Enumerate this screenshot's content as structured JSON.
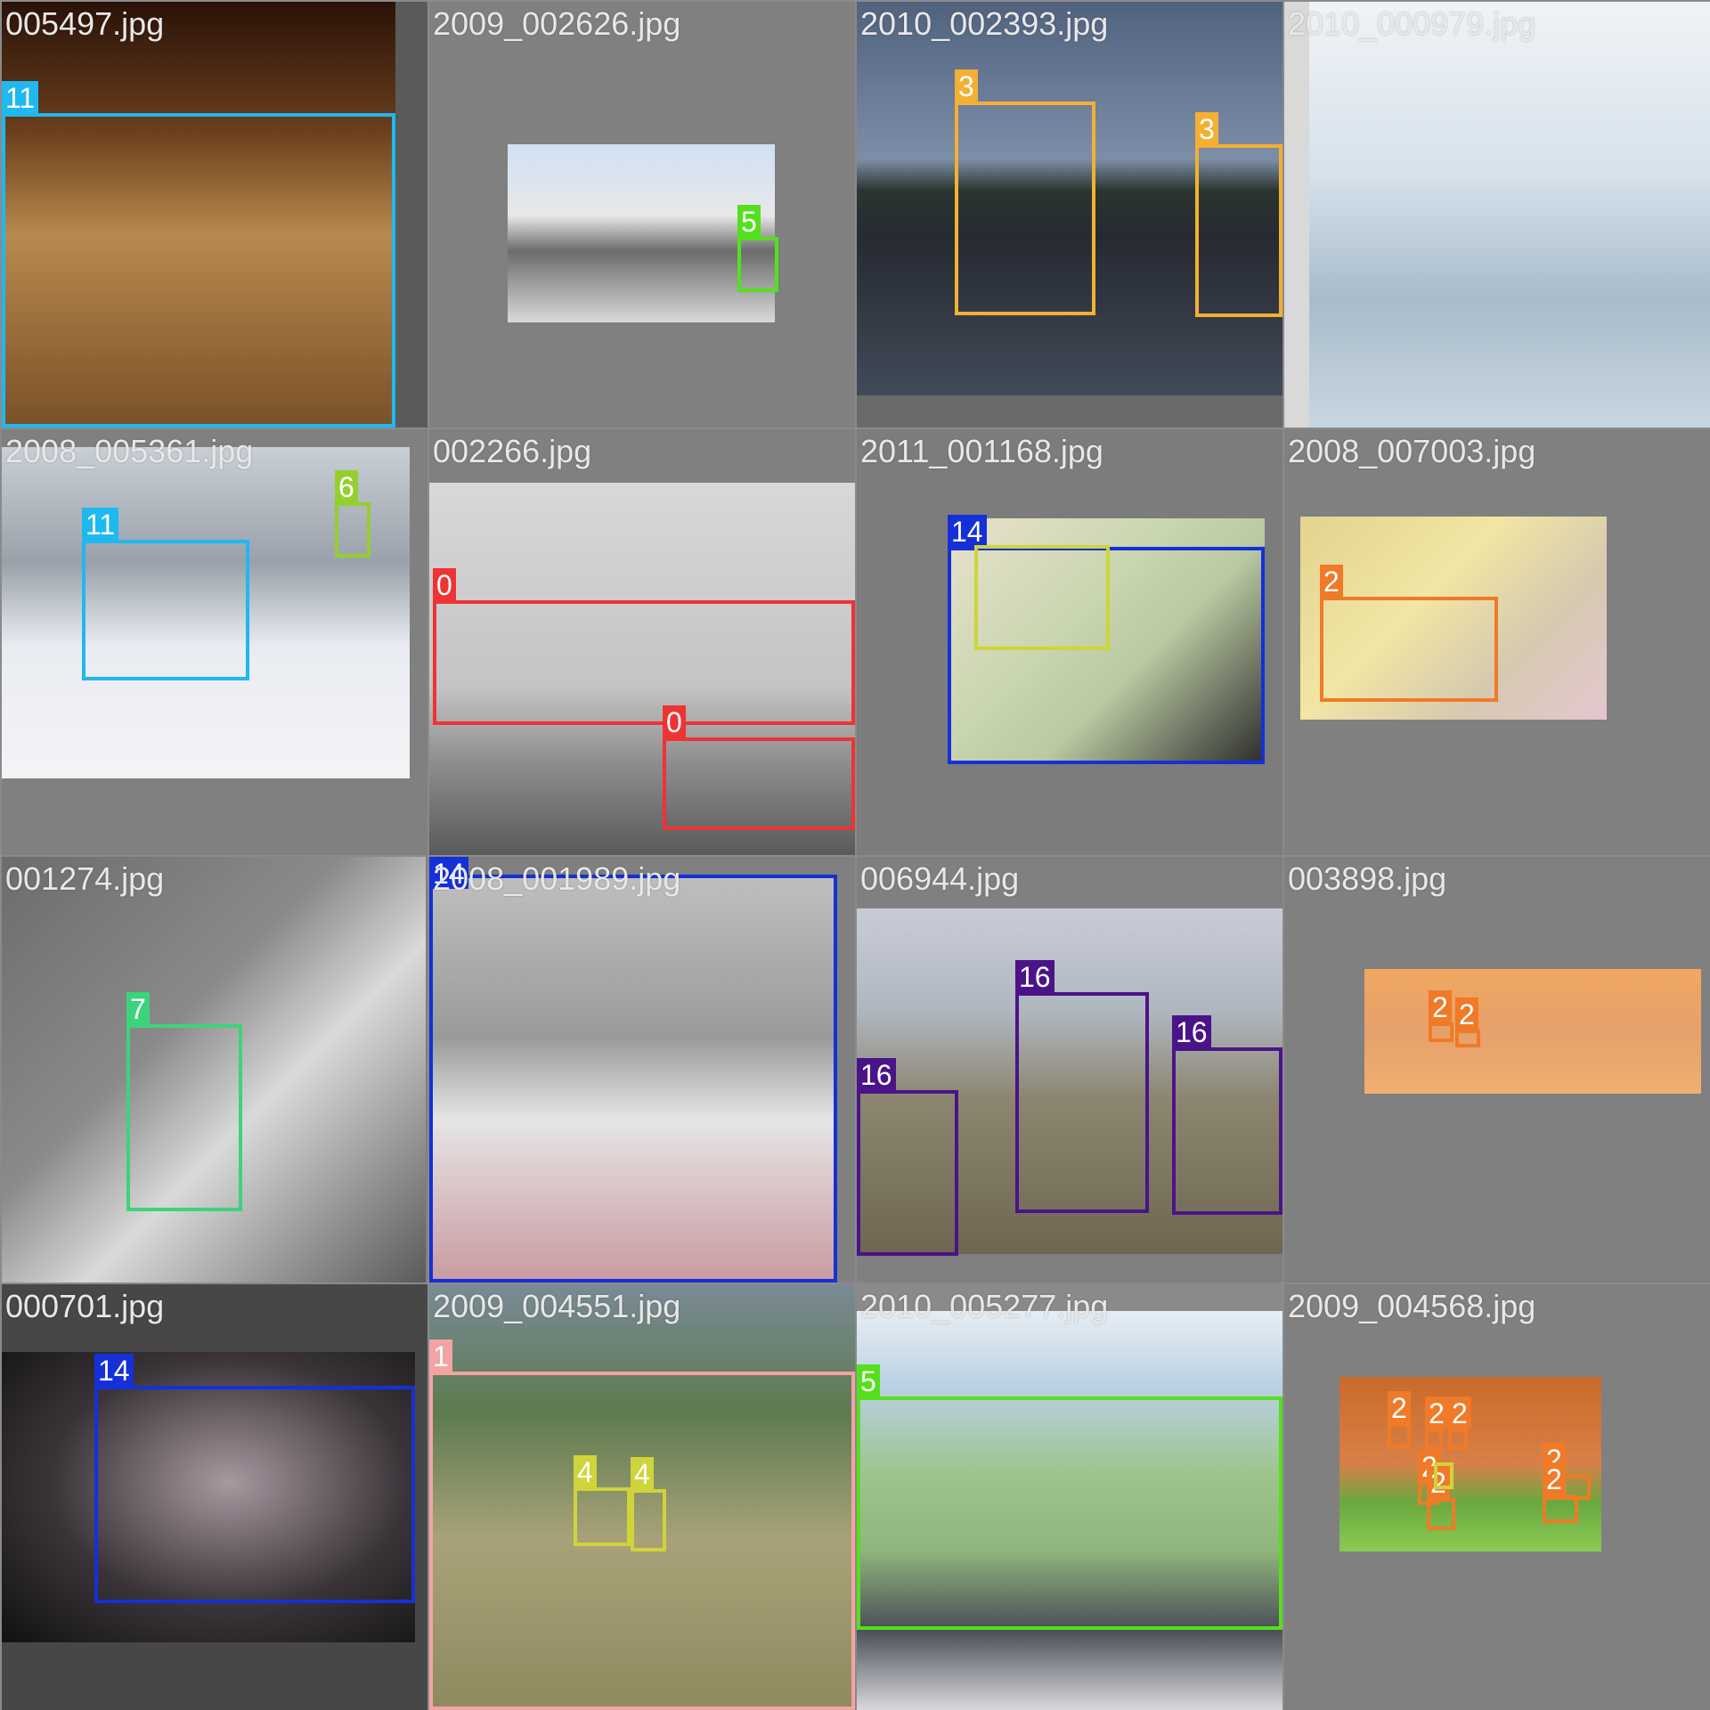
{
  "title": "",
  "class_colors": {
    "0": "#ee3333",
    "1": "#f4a3a3",
    "2": "#f07a28",
    "3": "#f3b033",
    "4": "#cfd43a",
    "5": "#55e01e",
    "6": "#95cf2e",
    "7": "#3cd47a",
    "11": "#1fb8f0",
    "14": "#1530d8",
    "16": "#4a1488"
  },
  "tiles": [
    {
      "filename": "005497.jpg",
      "scene": "dog",
      "boxes": [
        {
          "label": "11"
        }
      ]
    },
    {
      "filename": "2009_002626.jpg",
      "scene": "walkway",
      "boxes": [
        {
          "label": "5"
        }
      ]
    },
    {
      "filename": "2010_002393.jpg",
      "scene": "sailboats",
      "boxes": [
        {
          "label": "3"
        },
        {
          "label": "3"
        }
      ]
    },
    {
      "filename": "2010_000979.jpg",
      "scene": "skyline",
      "boxes": []
    },
    {
      "filename": "2008_005361.jpg",
      "scene": "snow-dog",
      "boxes": [
        {
          "label": "11"
        },
        {
          "label": "6"
        }
      ]
    },
    {
      "filename": "002266.jpg",
      "scene": "airplanes",
      "boxes": [
        {
          "label": "0"
        },
        {
          "label": "0"
        }
      ]
    },
    {
      "filename": "2011_001168.jpg",
      "scene": "baby-bottle",
      "boxes": [
        {
          "label": "14"
        },
        {
          "label": ""
        }
      ]
    },
    {
      "filename": "2008_007003.jpg",
      "scene": "hummingbird",
      "boxes": [
        {
          "label": "2"
        }
      ]
    },
    {
      "filename": "001274.jpg",
      "scene": "cat-tree",
      "boxes": [
        {
          "label": "7"
        }
      ]
    },
    {
      "filename": "2008_001989.jpg",
      "scene": "girl-mask",
      "boxes": [
        {
          "label": "14"
        }
      ]
    },
    {
      "filename": "006944.jpg",
      "scene": "sheep",
      "boxes": [
        {
          "label": "16"
        },
        {
          "label": "16"
        },
        {
          "label": "16"
        }
      ]
    },
    {
      "filename": "003898.jpg",
      "scene": "ducks",
      "boxes": [
        {
          "label": "2"
        },
        {
          "label": "2"
        }
      ]
    },
    {
      "filename": "000701.jpg",
      "scene": "eye-makeup",
      "boxes": [
        {
          "label": "14"
        }
      ]
    },
    {
      "filename": "2009_004551.jpg",
      "scene": "bicycle",
      "boxes": [
        {
          "label": "1"
        },
        {
          "label": "4"
        },
        {
          "label": "4"
        }
      ]
    },
    {
      "filename": "2010_005277.jpg",
      "scene": "bus",
      "boxes": [
        {
          "label": "5"
        }
      ]
    },
    {
      "filename": "2009_004568.jpg",
      "scene": "birds-lawn",
      "boxes": [
        {
          "label": "2"
        },
        {
          "label": "2"
        },
        {
          "label": "2"
        },
        {
          "label": "2"
        },
        {
          "label": "2"
        },
        {
          "label": "2"
        },
        {
          "label": "2"
        },
        {
          "label": ""
        }
      ]
    }
  ]
}
